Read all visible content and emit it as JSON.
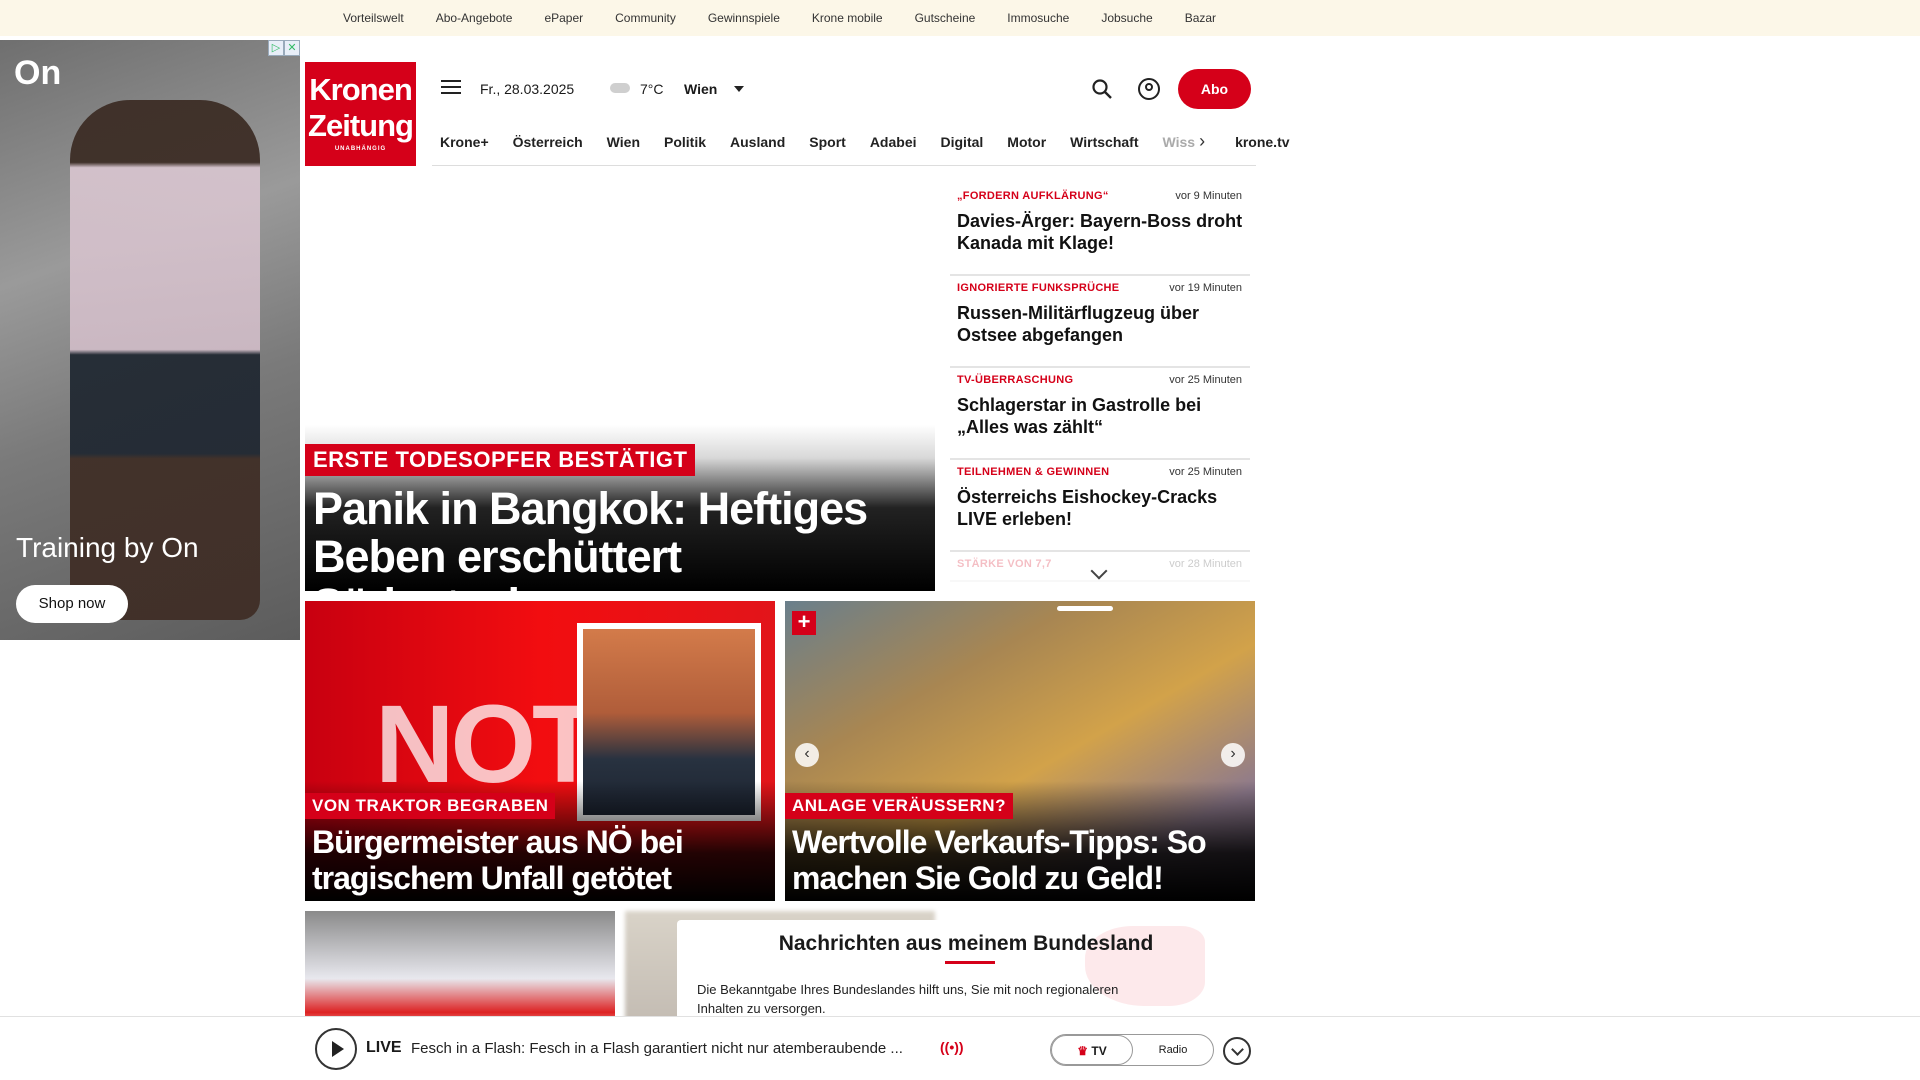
{
  "utility_nav": [
    "Vorteilswelt",
    "Abo-Angebote",
    "ePaper",
    "Community",
    "Gewinnspiele",
    "Krone mobile",
    "Gutscheine",
    "Immosuche",
    "Jobsuche",
    "Bazar"
  ],
  "ad": {
    "brand": "On",
    "tagline": "Training by On",
    "cta": "Shop now"
  },
  "brand": {
    "line1": "Kronen",
    "line2": "Zeitung",
    "line3": "UNABHÄNGIG"
  },
  "header": {
    "date": "Fr., 28.03.2025",
    "temperature": "7°C",
    "city": "Wien",
    "weather_icon": "cloud-icon",
    "abo_label": "Abo"
  },
  "nav": [
    "Krone+",
    "Österreich",
    "Wien",
    "Politik",
    "Ausland",
    "Sport",
    "Adabei",
    "Digital",
    "Motor",
    "Wirtschaft"
  ],
  "nav_faded": "Wiss",
  "nav_tv": "krone.tv",
  "hero": {
    "kicker": "ERSTE TODESOPFER BESTÄTIGT",
    "title": "Panik in Bangkok: Heftiges Beben erschüttert Südostasien"
  },
  "ticker": [
    {
      "kicker": "„FORDERN AUFKLÄRUNG“",
      "time": "vor 9 Minuten",
      "title": "Davies-Ärger: Bayern-Boss droht Kanada mit Klage!"
    },
    {
      "kicker": "IGNORIERTE FUNKSPRÜCHE",
      "time": "vor 19 Minuten",
      "title": "Russen-Militärflugzeug über Ostsee abgefangen"
    },
    {
      "kicker": "TV-ÜBERRASCHUNG",
      "time": "vor 25 Minuten",
      "title": "Schlagerstar in Gastrolle bei „Alles was zählt“"
    },
    {
      "kicker": "TEILNEHMEN & GEWINNEN",
      "time": "vor 25 Minuten",
      "title": "Österreichs Eishockey-Cracks LIVE erleben!"
    },
    {
      "kicker": "STÄRKE VON 7,7",
      "time": "vor 28 Minuten",
      "title": ""
    }
  ],
  "cards": [
    {
      "kicker": "VON TRAKTOR BEGRABEN",
      "title": "Bürgermeister aus NÖ bei tragischem Unfall getötet",
      "image_text": "NOTAR"
    },
    {
      "kicker": "ANLAGE VERÄUSSERN?",
      "title": "Wertvolle Verkaufs-Tipps: So machen Sie Gold zu Geld!"
    }
  ],
  "modal": {
    "title": "Nachrichten aus meinem Bundesland",
    "body": "Die Bekanntgabe Ihres Bundeslandes hilft uns, Sie mit noch regionaleren Inhalten zu versorgen."
  },
  "player": {
    "live_label": "LIVE",
    "stream": "Fesch in a Flash: Fesch in a Flash garantiert nicht nur atemberaubende ...",
    "tv_label": "TV",
    "radio_label": "Radio"
  },
  "colors": {
    "brand_red": "#d50019",
    "utility_bg": "#fcf7e8"
  }
}
